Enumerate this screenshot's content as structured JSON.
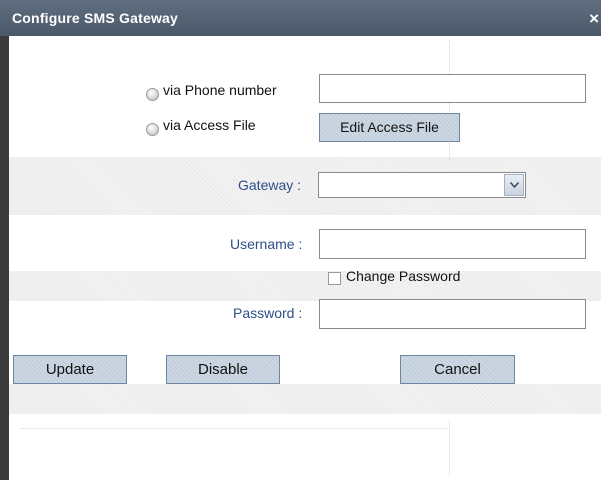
{
  "dialog": {
    "title": "Configure SMS Gateway",
    "close_symbol": "×"
  },
  "options": {
    "phone_label": "via Phone number",
    "phone_value": "",
    "file_label": "via Access File",
    "edit_file_button": "Edit Access File"
  },
  "form": {
    "gateway_label": "Gateway :",
    "gateway_value": "",
    "username_label": "Username :",
    "username_value": "",
    "change_password_label": "Change Password",
    "password_label": "Password :",
    "password_value": ""
  },
  "buttons": {
    "update": "Update",
    "disable": "Disable",
    "cancel": "Cancel"
  },
  "colors": {
    "title_bar": "#4f5c6e",
    "label_blue": "#2e4f87",
    "button_face": "#c3cfdd"
  }
}
